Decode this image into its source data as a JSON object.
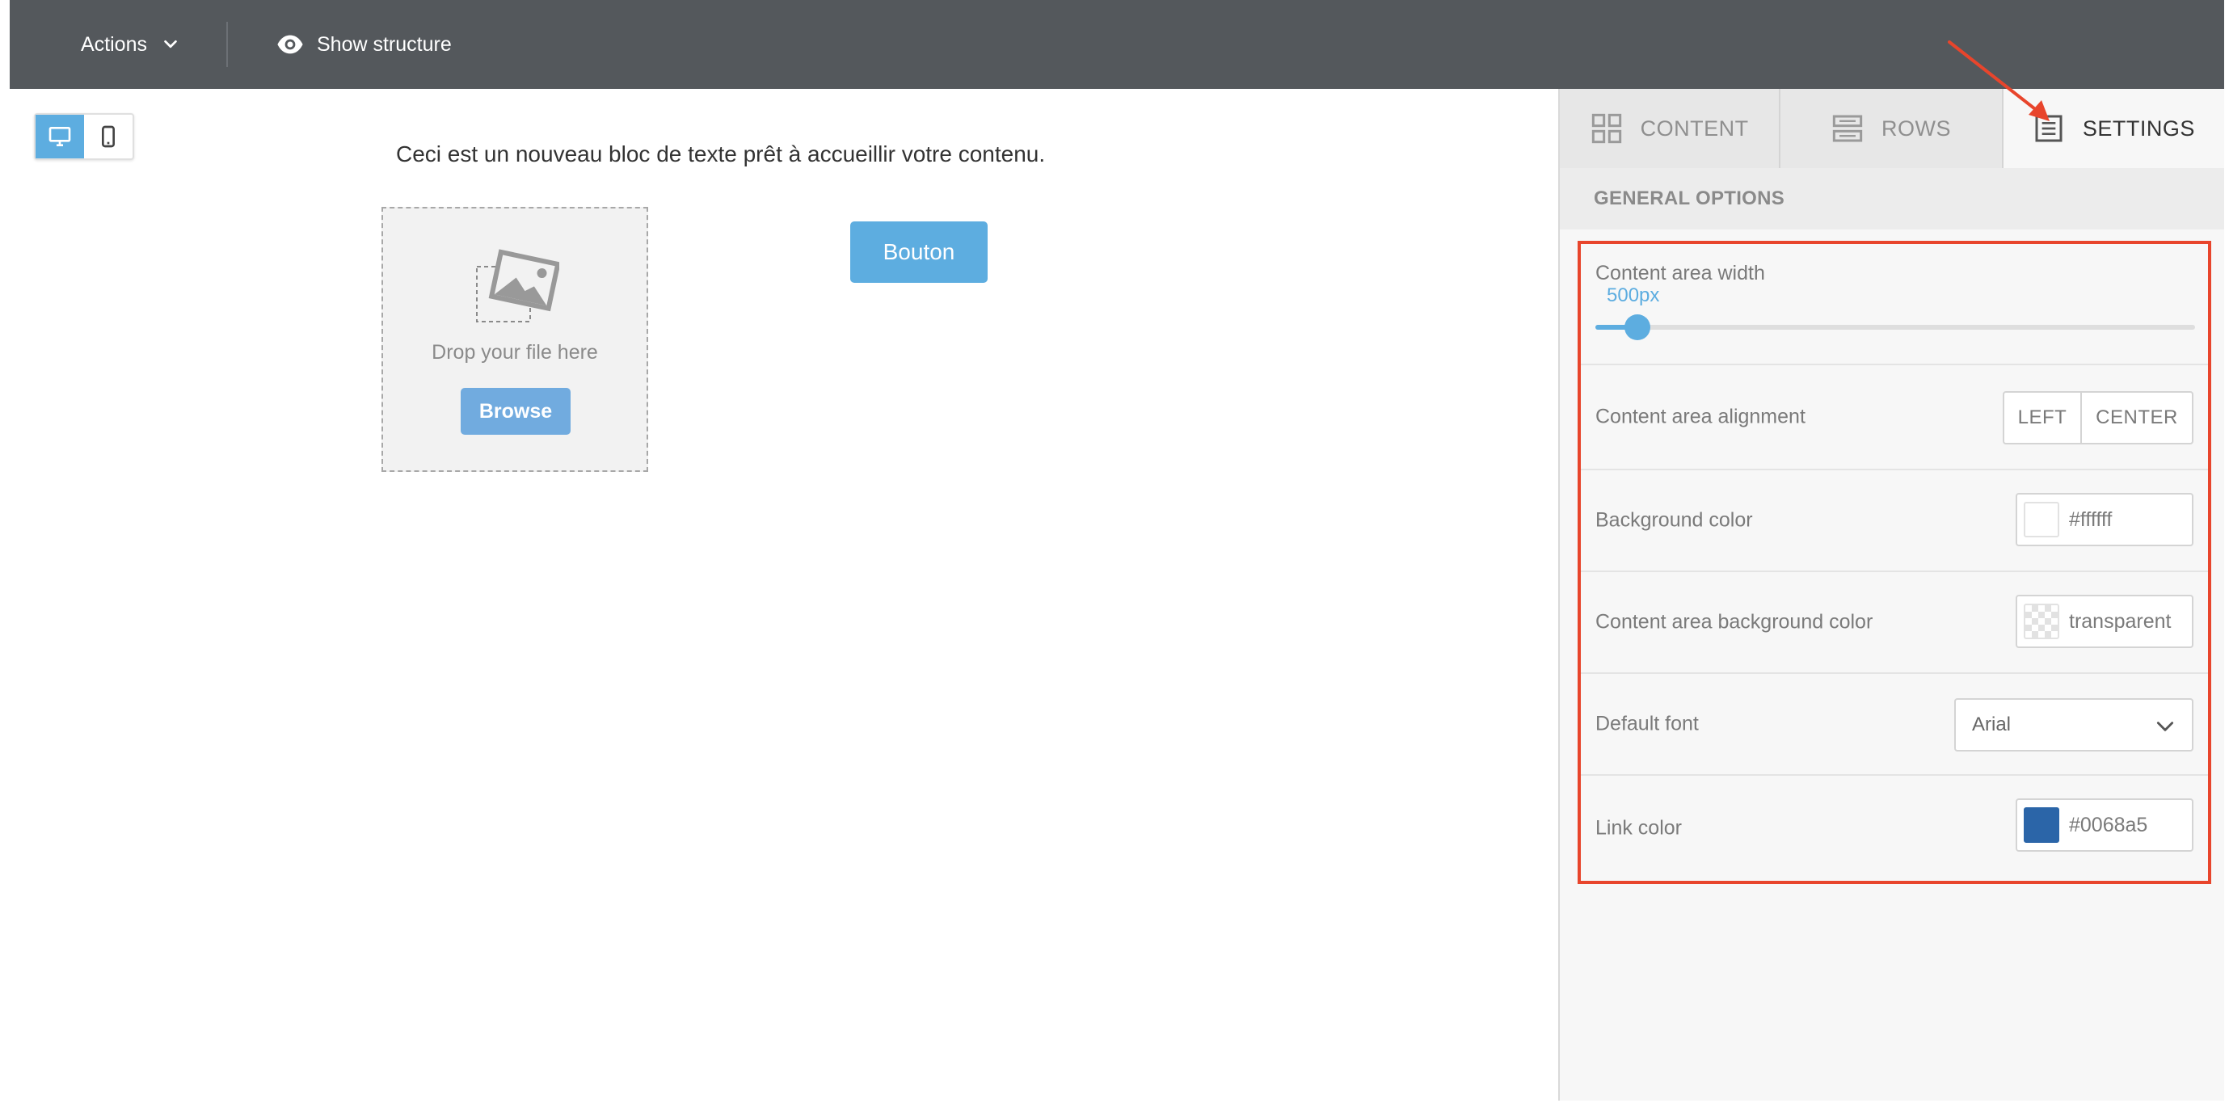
{
  "toolbar": {
    "actions_label": "Actions",
    "show_structure_label": "Show structure"
  },
  "device_toggle": {
    "active": "desktop"
  },
  "canvas": {
    "text_block": "Ceci est un nouveau bloc de texte prêt à accueillir votre contenu.",
    "drop_text": "Drop your file here",
    "browse_label": "Browse",
    "button_label": "Bouton"
  },
  "sidebar": {
    "tabs": {
      "content": "CONTENT",
      "rows": "ROWS",
      "settings": "SETTINGS"
    },
    "active_tab": "settings",
    "section_title": "GENERAL OPTIONS",
    "options": {
      "content_width": {
        "label": "Content area width",
        "value": "500px",
        "slider_fraction": 0.07
      },
      "alignment": {
        "label": "Content area alignment",
        "left": "LEFT",
        "center": "CENTER"
      },
      "background_color": {
        "label": "Background color",
        "value": "#ffffff"
      },
      "content_bg_color": {
        "label": "Content area background color",
        "value": "transparent"
      },
      "default_font": {
        "label": "Default font",
        "value": "Arial"
      },
      "link_color": {
        "label": "Link color",
        "value": "#0068a5"
      }
    }
  },
  "colors": {
    "topbar": "#54585c",
    "accent": "#5dade0",
    "highlight": "#e8452c"
  }
}
